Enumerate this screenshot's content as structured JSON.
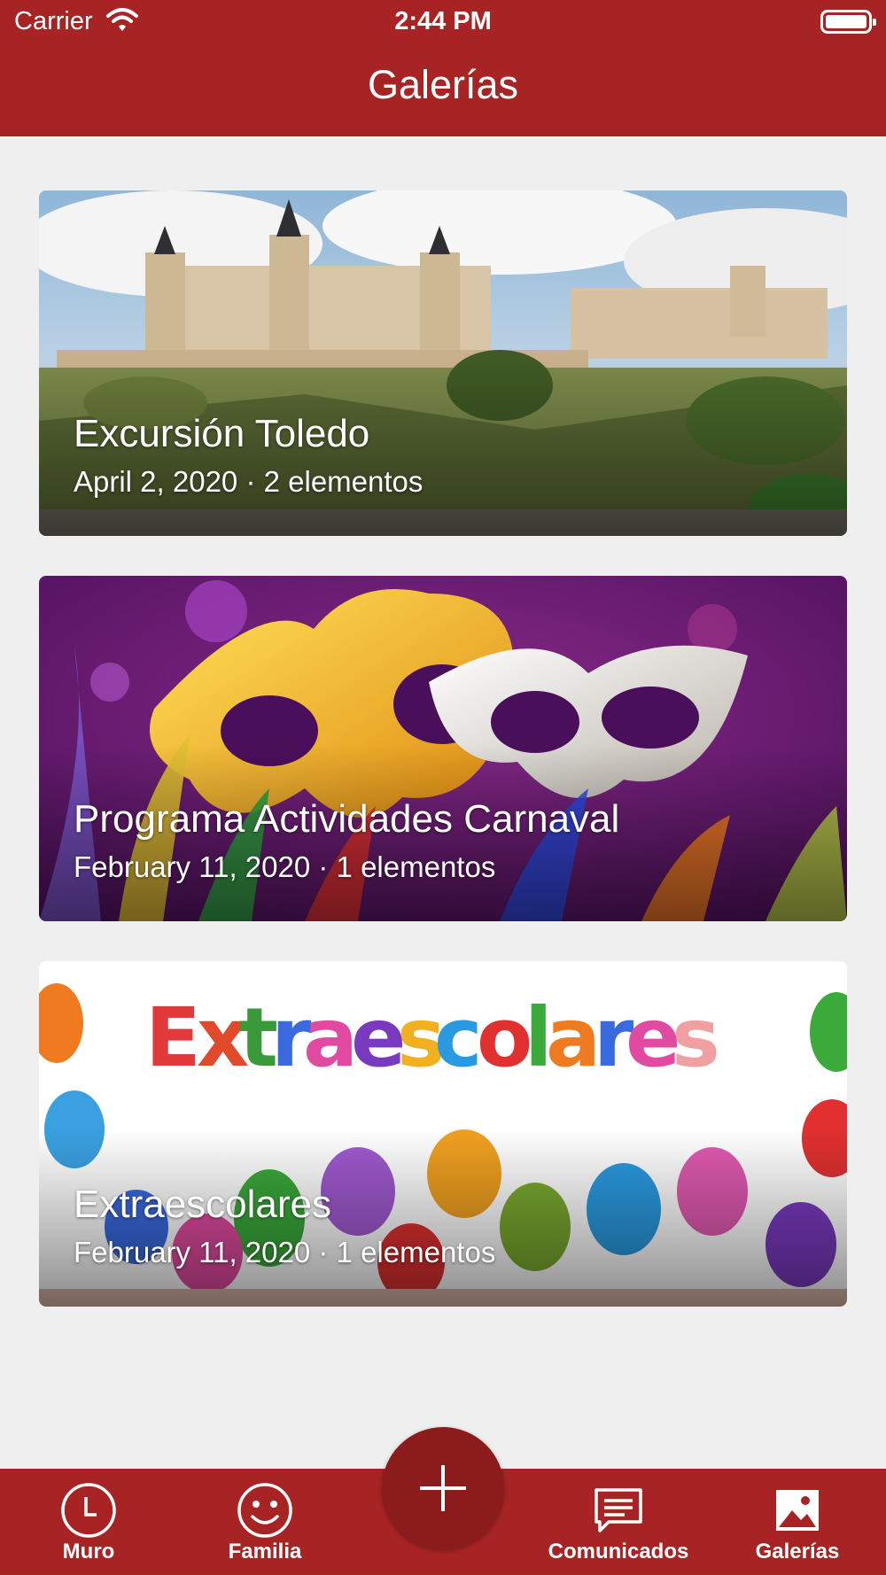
{
  "status_bar": {
    "carrier": "Carrier",
    "time": "2:44 PM"
  },
  "header": {
    "title": "Galerías"
  },
  "galleries": [
    {
      "title": "Excursión Toledo",
      "meta": "April 2, 2020 · 2 elementos"
    },
    {
      "title": "Programa Actividades Carnaval",
      "meta": "February 11, 2020 · 1 elementos"
    },
    {
      "title": "Extraescolares",
      "meta": "February 11, 2020 · 1 elementos",
      "banner_text": "Extraescolares"
    }
  ],
  "tab_bar": {
    "tabs": [
      {
        "label": "Muro",
        "icon": "clock-icon"
      },
      {
        "label": "Familia",
        "icon": "smiley-icon"
      },
      {
        "label": "Comunicados",
        "icon": "chat-icon"
      },
      {
        "label": "Galerías",
        "icon": "image-icon"
      }
    ],
    "fab_icon": "plus-icon"
  },
  "colors": {
    "primary": "#a82424",
    "fab": "#8c1c1c",
    "background": "#efefef"
  }
}
